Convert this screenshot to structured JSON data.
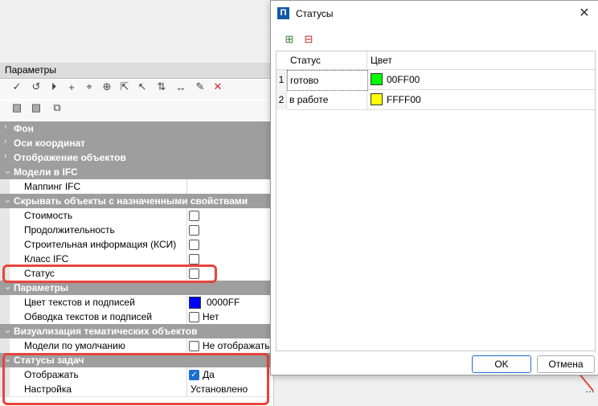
{
  "params_panel": {
    "title": "Параметры",
    "groups": {
      "fon": "Фон",
      "osi": "Оси координат",
      "otobr": "Отображение объектов",
      "ifc": "Модели в IFC",
      "hide": "Скрывать объекты с назначенными свойствами",
      "params": "Параметры",
      "viz": "Визуализация тематических объектов",
      "status_tasks": "Статусы задач"
    },
    "rows": {
      "mapping": "Маппинг IFC",
      "cost": "Стоимость",
      "duration": "Продолжительность",
      "ksi": "Строительная информация (КСИ)",
      "ifc_class": "Класс IFC",
      "status": "Статус",
      "text_color": "Цвет текстов и подписей",
      "text_color_value": "0000FF",
      "text_outline": "Обводка текстов и подписей",
      "text_outline_value": "Нет",
      "default_models": "Модели по умолчанию",
      "default_models_value": "Не отображать",
      "display": "Отображать",
      "display_value": "Да",
      "setting": "Настройка",
      "setting_value": "Установлено"
    },
    "colors": {
      "text_color_swatch": "#0000ff",
      "group_bg": "#9e9e9e",
      "highlight": "#e8453c"
    }
  },
  "dialog": {
    "title": "Статусы",
    "icon_letter": "П",
    "close": "✕",
    "columns": {
      "status": "Статус",
      "color": "Цвет"
    },
    "rows": [
      {
        "num": "1",
        "status": "готово",
        "color": "00FF00",
        "swatch": "#00ff00"
      },
      {
        "num": "2",
        "status": "в работе",
        "color": "FFFF00",
        "swatch": "#ffff00"
      }
    ],
    "ok": "OK",
    "cancel": "Отмена"
  }
}
